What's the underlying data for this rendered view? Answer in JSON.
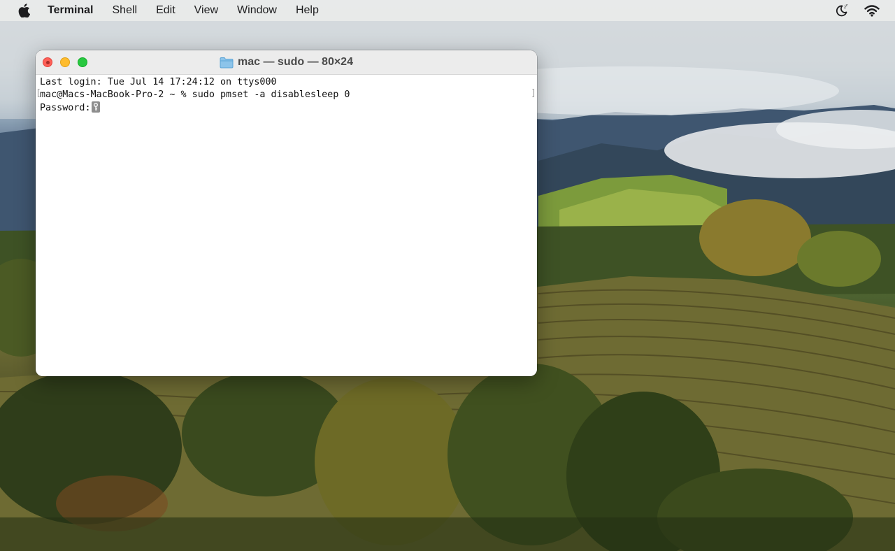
{
  "menubar": {
    "app_name": "Terminal",
    "items": [
      "Shell",
      "Edit",
      "View",
      "Window",
      "Help"
    ]
  },
  "window": {
    "title": "mac — sudo — 80×24"
  },
  "terminal": {
    "lines": [
      "Last login: Tue Jul 14 17:24:12 on ttys000",
      "mac@Macs-MacBook-Pro-2 ~ % sudo pmset -a disablesleep 0",
      "Password:"
    ]
  },
  "colors": {
    "close": "#ff5f57",
    "minimize": "#febc2e",
    "maximize": "#28c840"
  },
  "icons": [
    "apple-icon",
    "do-not-disturb-icon",
    "wifi-icon",
    "folder-icon",
    "key-cursor-icon"
  ]
}
